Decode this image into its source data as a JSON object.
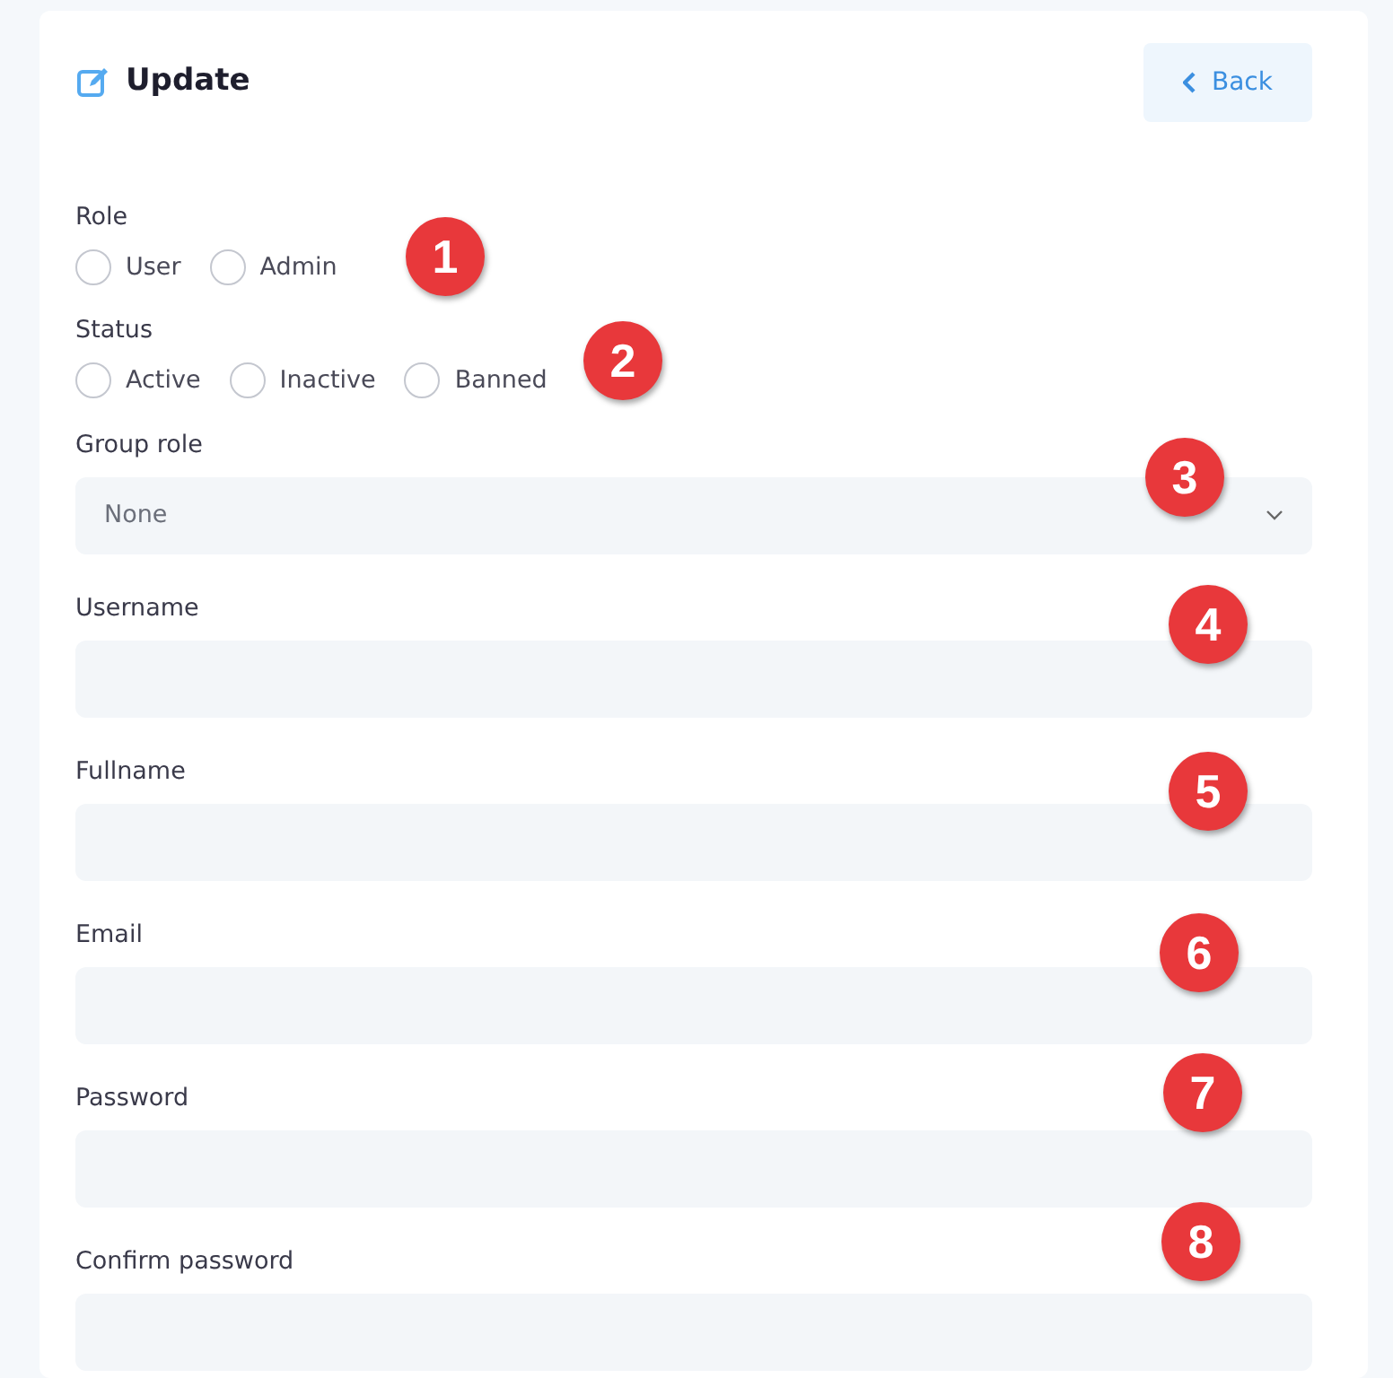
{
  "header": {
    "title": "Update",
    "back_button": "Back"
  },
  "fields": [
    {
      "kind": "radio",
      "label": "Role",
      "options": [
        {
          "label": "User",
          "selected": false
        },
        {
          "label": "Admin",
          "selected": false
        }
      ]
    },
    {
      "kind": "radio",
      "label": "Status",
      "options": [
        {
          "label": "Active",
          "selected": false
        },
        {
          "label": "Inactive",
          "selected": false
        },
        {
          "label": "Banned",
          "selected": false
        }
      ]
    },
    {
      "kind": "select",
      "label": "Group role",
      "value": "None"
    },
    {
      "kind": "text",
      "label": "Username"
    },
    {
      "kind": "text",
      "label": "Fullname"
    },
    {
      "kind": "text",
      "label": "Email"
    },
    {
      "kind": "text",
      "label": "Password"
    },
    {
      "kind": "text",
      "label": "Confirm password"
    }
  ],
  "markers": [
    "1",
    "2",
    "3",
    "4",
    "5",
    "6",
    "7",
    "8"
  ]
}
